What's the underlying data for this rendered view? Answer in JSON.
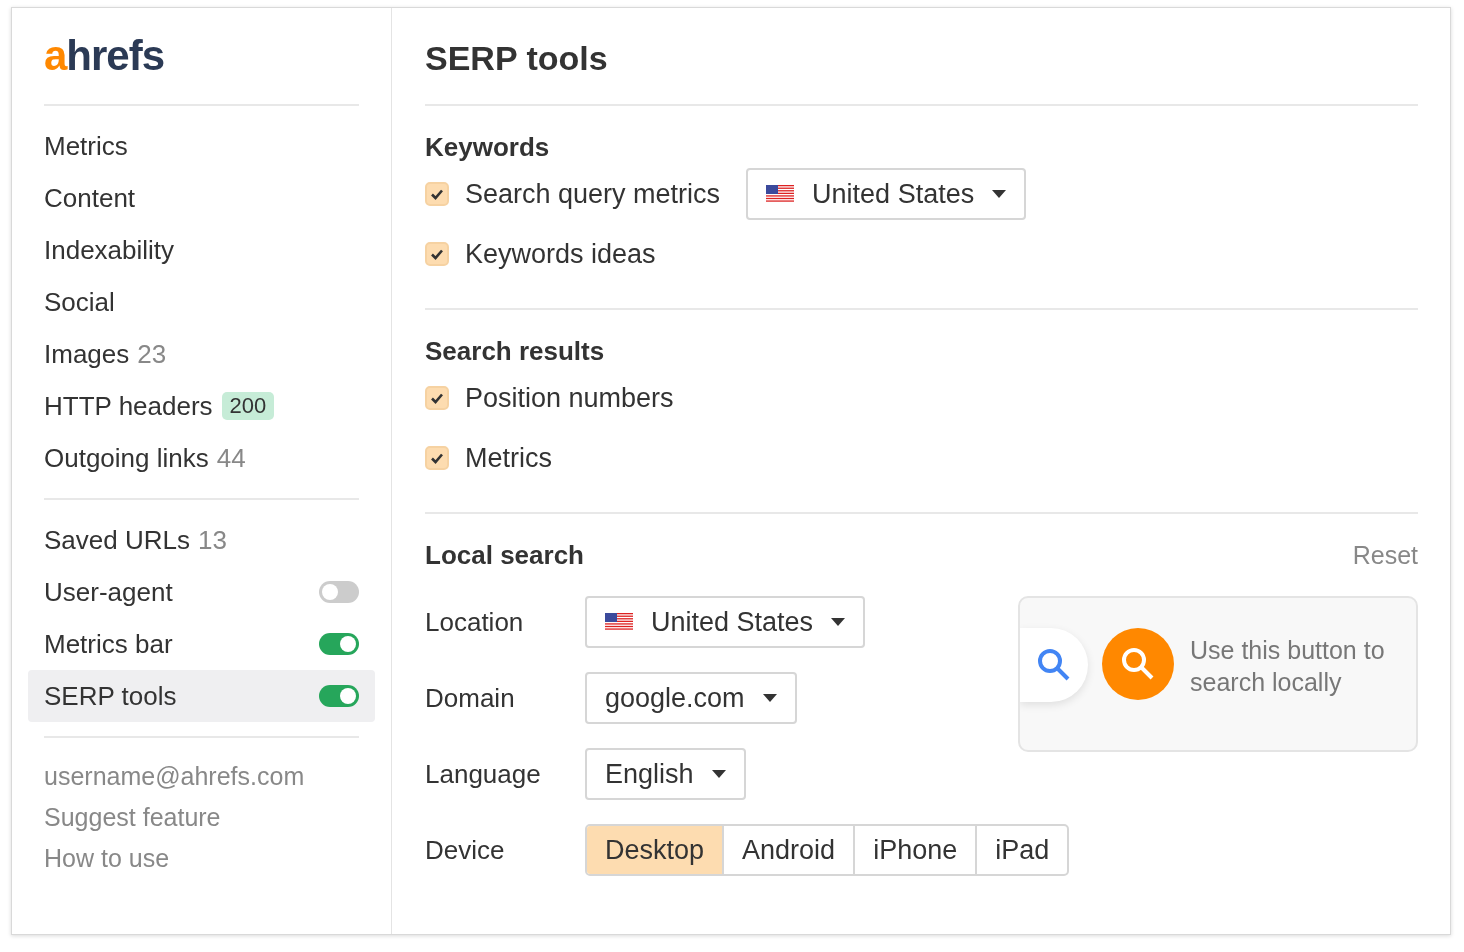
{
  "sidebar": {
    "logo": {
      "accent": "a",
      "rest": "hrefs"
    },
    "groups": [
      {
        "items": [
          {
            "kind": "plain",
            "label": "Metrics",
            "selected": false
          },
          {
            "kind": "plain",
            "label": "Content",
            "selected": false
          },
          {
            "kind": "plain",
            "label": "Indexability",
            "selected": false
          },
          {
            "kind": "plain",
            "label": "Social",
            "selected": false
          },
          {
            "kind": "count",
            "label": "Images",
            "count": "23",
            "selected": false
          },
          {
            "kind": "badge",
            "label": "HTTP headers",
            "badge": "200",
            "selected": false
          },
          {
            "kind": "count",
            "label": "Outgoing links",
            "count": "44",
            "selected": false
          }
        ]
      },
      {
        "items": [
          {
            "kind": "count",
            "label": "Saved URLs",
            "count": "13",
            "selected": false
          },
          {
            "kind": "toggle",
            "label": "User-agent",
            "on": false,
            "selected": false
          },
          {
            "kind": "toggle",
            "label": "Metrics bar",
            "on": true,
            "selected": false
          },
          {
            "kind": "toggle",
            "label": "SERP tools",
            "on": true,
            "selected": true
          }
        ]
      }
    ],
    "footer_links": [
      "username@ahrefs.com",
      "Suggest feature",
      "How to use"
    ]
  },
  "main": {
    "title": "SERP tools",
    "sections": [
      {
        "heading": "Keywords",
        "options": [
          {
            "label": "Search query metrics",
            "checked": true,
            "dropdown": "United States"
          },
          {
            "label": "Keywords ideas",
            "checked": true
          }
        ]
      },
      {
        "heading": "Search results",
        "options": [
          {
            "label": "Position numbers",
            "checked": true
          },
          {
            "label": "Metrics",
            "checked": true
          }
        ]
      }
    ],
    "local_search": {
      "heading": "Local search",
      "reset": "Reset",
      "fields": [
        {
          "kind": "select",
          "label": "Location",
          "value": "United States",
          "flag": true
        },
        {
          "kind": "select",
          "label": "Domain",
          "value": "google.com"
        },
        {
          "kind": "select",
          "label": "Language",
          "value": "English"
        },
        {
          "kind": "segmented",
          "label": "Device",
          "options": [
            {
              "label": "Desktop",
              "selected": true
            },
            {
              "label": "Android",
              "selected": false
            },
            {
              "label": "iPhone",
              "selected": false
            },
            {
              "label": "iPad",
              "selected": false
            }
          ]
        }
      ],
      "hint": "Use this button to search locally"
    }
  }
}
